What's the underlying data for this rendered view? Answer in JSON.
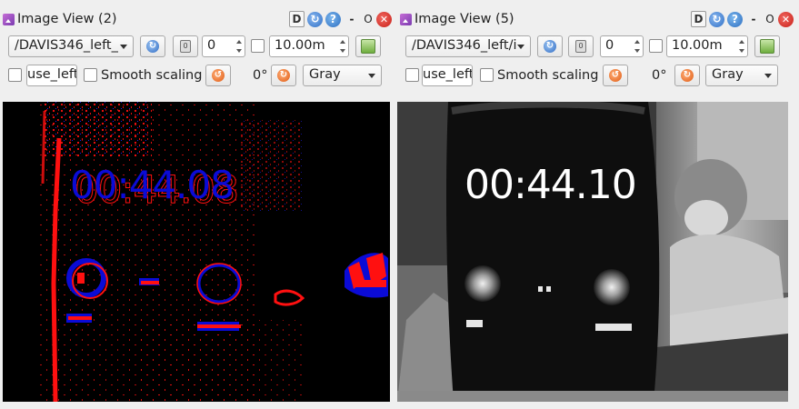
{
  "panes": [
    {
      "title": "Image View (2)",
      "topic": "/DAVIS346_left_",
      "frame_value": "0",
      "timeout_value": "10.00m",
      "text_field": "use_left",
      "smooth_scaling_label": "Smooth scaling",
      "smooth_scaling_checked": false,
      "rotation_label": "0°",
      "colormap": "Gray",
      "image_text": "00:44.08",
      "image_style": "event-camera red/blue"
    },
    {
      "title": "Image View (5)",
      "topic": "/DAVIS346_left/i",
      "frame_value": "0",
      "timeout_value": "10.00m",
      "text_field": "use_left",
      "smooth_scaling_label": "Smooth scaling",
      "smooth_scaling_checked": false,
      "rotation_label": "0°",
      "colormap": "Gray",
      "image_text": "00:44.10",
      "image_style": "grayscale frame"
    }
  ],
  "titlebar_buttons": [
    "D",
    "reload-icon",
    "help-icon",
    "-",
    "O",
    "close-icon"
  ],
  "colors": {
    "event_red": "#ff1010",
    "event_blue": "#0b0bd6",
    "background": "#efefef"
  }
}
